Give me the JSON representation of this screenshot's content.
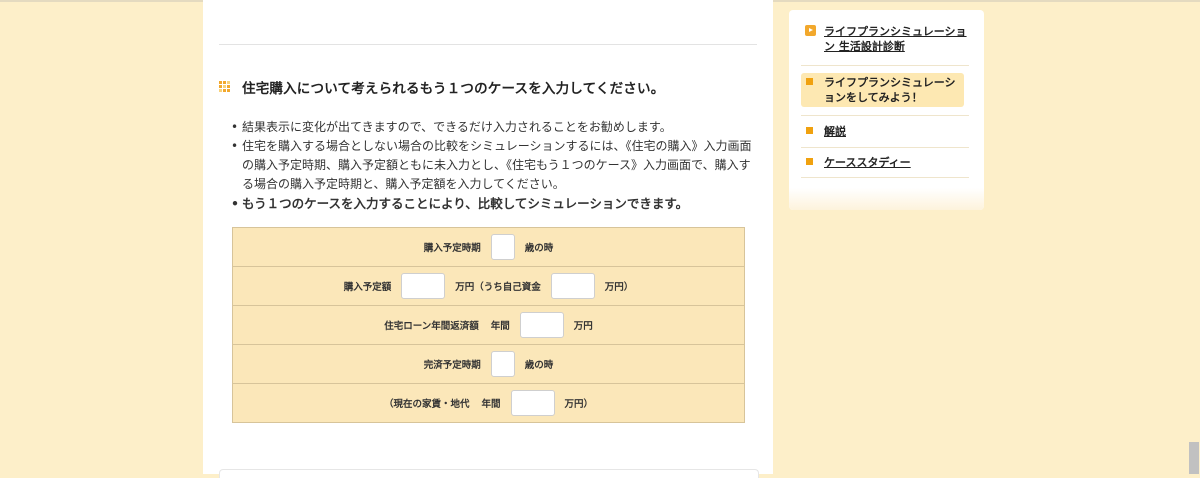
{
  "main": {
    "section_title": "住宅購入について考えられるもう１つのケースを入力してください。",
    "notes": [
      "結果表示に変化が出てきますので、できるだけ入力されることをお勧めします。",
      "住宅を購入する場合としない場合の比較をシミュレーションするには、《住宅の購入》入力画面の購入予定時期、購入予定額ともに未入力とし、《住宅もう１つのケース》入力画面で、購入する場合の購入予定時期と、購入予定額を入力してください。",
      "もう１つのケースを入力することにより、比較してシミュレーションできます。"
    ],
    "form": {
      "purchase_time": {
        "label": "購入予定時期",
        "suffix": "歳の時",
        "value": ""
      },
      "purchase_amount": {
        "label": "購入予定額",
        "middle": "万円（うち自己資金",
        "suffix": "万円）",
        "value": "",
        "own_funds_value": ""
      },
      "loan_repayment": {
        "label": "住宅ローン年間返済額",
        "unit_prefix": "年間",
        "suffix": "万円",
        "value": ""
      },
      "completion_time": {
        "label": "完済予定時期",
        "suffix": "歳の時",
        "value": ""
      },
      "current_rent": {
        "label": "（現在の家賃・地代",
        "unit_prefix": "年間",
        "suffix": "万円）",
        "value": ""
      }
    }
  },
  "sidebar": {
    "items": [
      {
        "label": "ライフプランシミュレーション 生活設計診断",
        "icon": "play-icon"
      },
      {
        "label": "ライフプランシミュレーションをしてみよう！",
        "icon": "square-bullet-icon",
        "active": true
      },
      {
        "label": "解説",
        "icon": "square-bullet-icon"
      },
      {
        "label": "ケーススタディー",
        "icon": "square-bullet-icon"
      }
    ]
  },
  "colors": {
    "page_bg": "#fdefc9",
    "accent": "#f2a82c",
    "table_bg": "#fbe7b9",
    "active_item_bg": "#fde8b2"
  }
}
